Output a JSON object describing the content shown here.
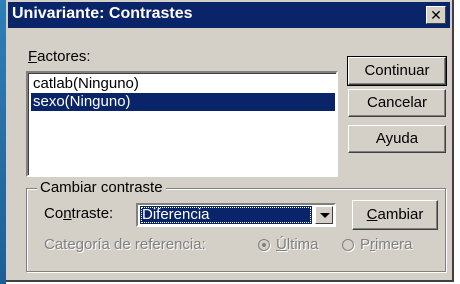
{
  "window": {
    "title": "Univariante: Contrastes",
    "close_glyph": "✕"
  },
  "factors": {
    "label": "Factores:",
    "items": [
      {
        "label": "catlab(Ninguno)",
        "selected": false
      },
      {
        "label": "sexo(Ninguno)",
        "selected": true
      }
    ]
  },
  "buttons": {
    "continuar": "Continuar",
    "cancelar": "Cancelar",
    "ayuda": "Ayuda",
    "cambiar": "Cambiar"
  },
  "change_contrast": {
    "group_title": "Cambiar contraste",
    "contrast_label": "Contraste:",
    "contrast_value": "Diferencia",
    "reference_label": "Categoría de referencia:",
    "radio_last": "Última",
    "radio_first": "Primera",
    "selected_reference": "Última",
    "enabled": false
  },
  "colors": {
    "title_bar": "#0a246a",
    "face": "#d4d0c8",
    "selection": "#0a246a"
  },
  "icons": {
    "close": "close-icon",
    "dropdown": "chevron-down-icon"
  }
}
